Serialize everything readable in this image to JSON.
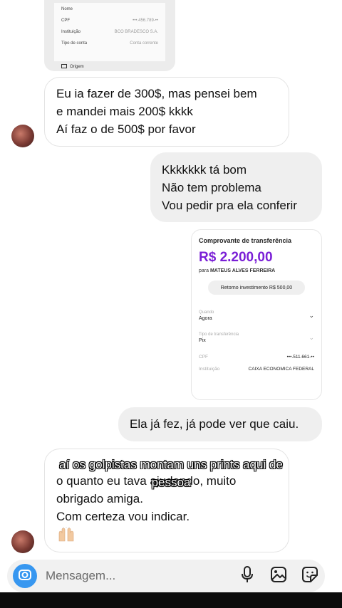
{
  "top_receipt": {
    "rows": [
      {
        "label": "Nome",
        "value": ""
      },
      {
        "label": "CPF",
        "value": "•••.456.789-••"
      },
      {
        "label": "Instituição",
        "value": "BCO BRADESCO S.A."
      },
      {
        "label": "Tipo de conta",
        "value": "Conta corrente"
      }
    ],
    "origin_label": "Origem"
  },
  "messages": {
    "msg1": [
      "Eu ia fazer de 300$, mas pensei bem",
      "e mandei mais 200$ kkkk",
      "Aí faz o de 500$ por favor"
    ],
    "msg2": [
      "Kkkkkkk tá bom",
      "Não tem problema",
      "Vou pedir pra ela conferir"
    ],
    "msg3": "Ela já fez, já pode ver que caiu.",
    "msg4": [
      "o quanto eu tava ajudando, muito",
      "obrigado amiga.",
      "Com certeza vou indicar."
    ]
  },
  "receipt": {
    "title": "Comprovante de transferência",
    "amount": "R$ 2.200,00",
    "to_prefix": "para",
    "to_name": "MATEUS ALVES FERREIRA",
    "pill": "Retorno investimento R$ 500,00",
    "when_label": "Quando",
    "when_value": "Agora",
    "type_label": "Tipo de transferência",
    "type_value": "Pix",
    "cpf_label": "CPF",
    "cpf_value": "•••.511.661-••",
    "inst_label": "Instituição",
    "inst_value": "CAIXA ECONOMICA FEDERAL"
  },
  "caption": {
    "line1": "aí os golpistas montam uns prints aqui de",
    "line2": "pessoa"
  },
  "composer": {
    "placeholder": "Mensagem..."
  },
  "icons": {
    "camera": "camera-icon",
    "mic": "microphone-icon",
    "gallery": "gallery-icon",
    "sticker": "sticker-icon",
    "emoji": "raised-hands-emoji"
  },
  "colors": {
    "accent": "#3797f0",
    "amount": "#7a1fd6"
  }
}
